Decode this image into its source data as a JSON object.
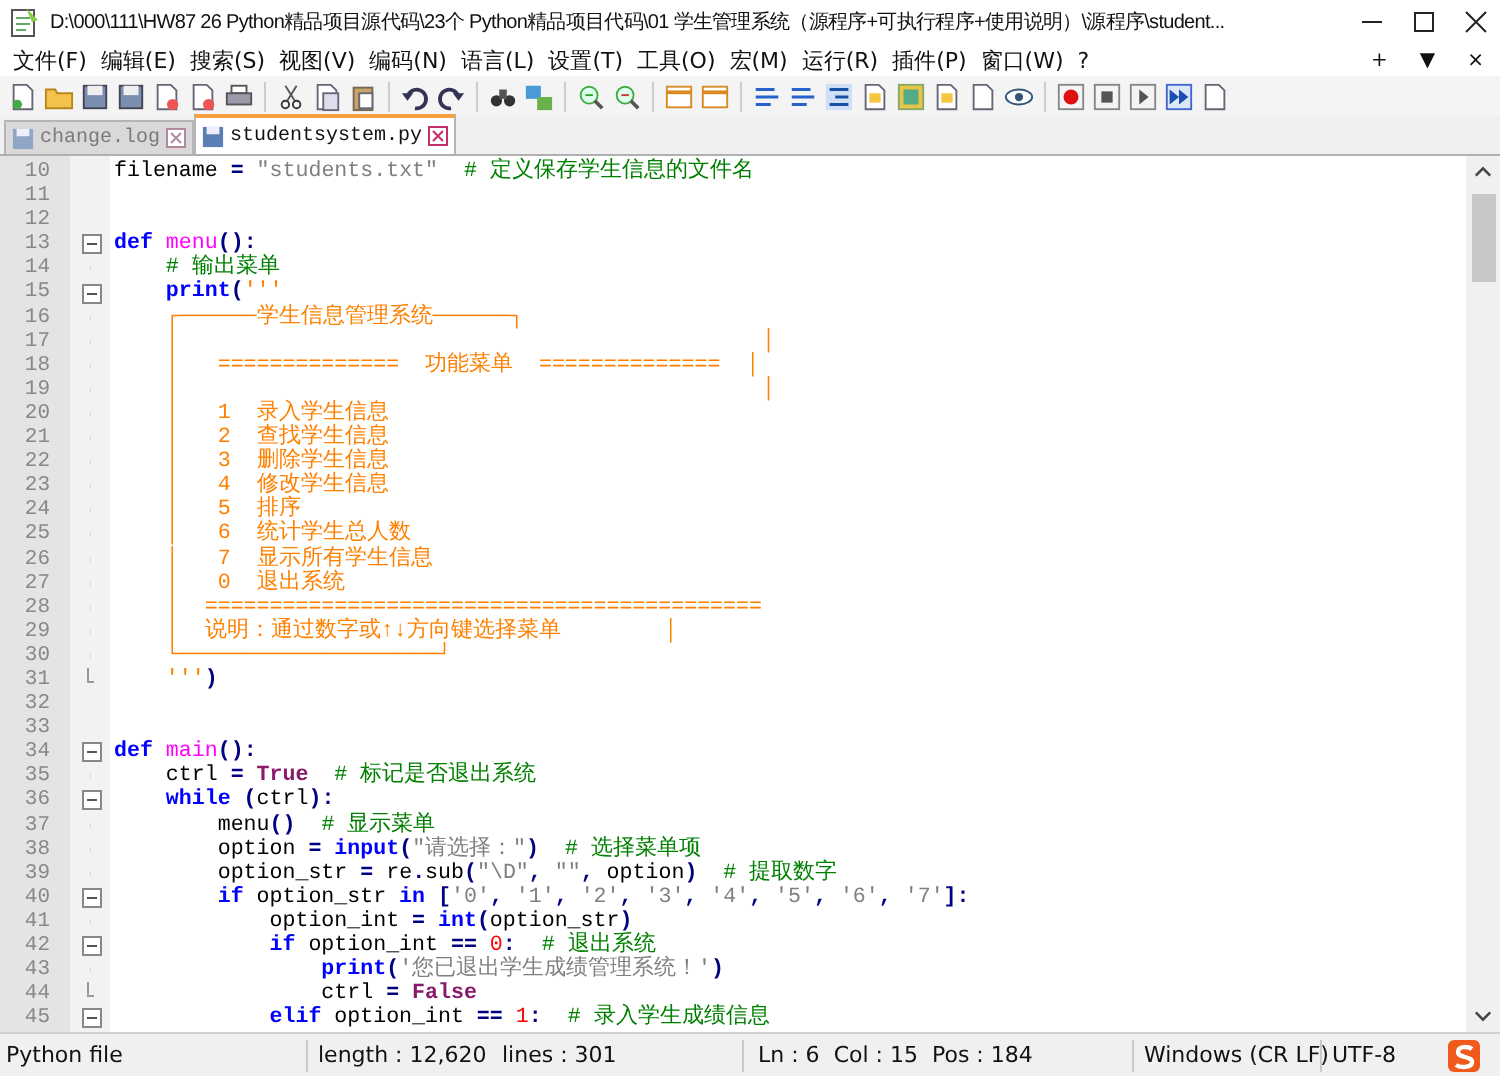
{
  "window": {
    "title": "D:\\000\\111\\HW87 26 Python精品项目源代码\\23个 Python精品项目代码\\01 学生管理系统（源程序+可执行程序+使用说明）\\源程序\\student..."
  },
  "menu": [
    "文件(F)",
    "编辑(E)",
    "搜索(S)",
    "视图(V)",
    "编码(N)",
    "语言(L)",
    "设置(T)",
    "工具(O)",
    "宏(M)",
    "运行(R)",
    "插件(P)",
    "窗口(W)",
    "?"
  ],
  "menu_right": [
    "+",
    "▼",
    "×"
  ],
  "tabs": [
    {
      "label": "change.log",
      "selected": false
    },
    {
      "label": "studentsystem.py",
      "selected": true
    }
  ],
  "lines": [
    {
      "n": "10",
      "code": [
        {
          "kind": "id",
          "t": "filename"
        },
        {
          "kind": "op",
          "t": " ="
        },
        {
          "kind": "str",
          "t": " \"students.txt\""
        },
        {
          "kind": "cmt",
          "t": "  # 定义保存学生信息的文件名"
        }
      ]
    },
    {
      "n": "11"
    },
    {
      "n": "12"
    },
    {
      "n": "13",
      "kind": "open",
      "code": [
        {
          "kind": "kw",
          "t": "def"
        },
        {
          "kind": "fn",
          "t": " menu"
        },
        {
          "kind": "op",
          "t": "():"
        }
      ]
    },
    {
      "n": "14",
      "kind": "line",
      "code": [
        {
          "kind": "cmt",
          "t": "    # 输出菜单"
        }
      ]
    },
    {
      "n": "15",
      "kind": "open",
      "code": [
        {
          "kind": "kw",
          "t": "    print"
        },
        {
          "kind": "op",
          "t": "("
        },
        {
          "kind": "doc",
          "t": "'''"
        }
      ]
    },
    {
      "n": "16",
      "kind": "line",
      "code": [
        {
          "kind": "doc",
          "t": "    ┌──────学生信息管理系统──────┐"
        }
      ]
    },
    {
      "n": "17",
      "kind": "line",
      "code": [
        {
          "kind": "doc",
          "t": "    │                                             │"
        }
      ]
    },
    {
      "n": "18",
      "kind": "line",
      "code": [
        {
          "kind": "doc",
          "t": "    │   ==============  功能菜单  ==============  │"
        }
      ]
    },
    {
      "n": "19",
      "kind": "line",
      "code": [
        {
          "kind": "doc",
          "t": "    │                                             │"
        }
      ]
    },
    {
      "n": "20",
      "kind": "line",
      "code": [
        {
          "kind": "doc",
          "t": "    │   1  录入学生信息"
        }
      ]
    },
    {
      "n": "21",
      "kind": "line",
      "code": [
        {
          "kind": "doc",
          "t": "    │   2  查找学生信息"
        }
      ]
    },
    {
      "n": "22",
      "kind": "line",
      "code": [
        {
          "kind": "doc",
          "t": "    │   3  删除学生信息"
        }
      ]
    },
    {
      "n": "23",
      "kind": "line",
      "code": [
        {
          "kind": "doc",
          "t": "    │   4  修改学生信息"
        }
      ]
    },
    {
      "n": "24",
      "kind": "line",
      "code": [
        {
          "kind": "doc",
          "t": "    │   5  排序"
        }
      ]
    },
    {
      "n": "25",
      "kind": "line",
      "code": [
        {
          "kind": "doc",
          "t": "    │   6  统计学生总人数"
        }
      ]
    },
    {
      "n": "26",
      "kind": "line",
      "code": [
        {
          "kind": "doc",
          "t": "    │   7  显示所有学生信息"
        }
      ]
    },
    {
      "n": "27",
      "kind": "line",
      "code": [
        {
          "kind": "doc",
          "t": "    │   0  退出系统"
        }
      ]
    },
    {
      "n": "28",
      "kind": "line",
      "code": [
        {
          "kind": "doc",
          "t": "    │  ==========================================="
        }
      ]
    },
    {
      "n": "29",
      "kind": "line",
      "code": [
        {
          "kind": "doc",
          "t": "    │  说明：通过数字或↑↓方向键选择菜单        │"
        }
      ]
    },
    {
      "n": "30",
      "kind": "line",
      "code": [
        {
          "kind": "doc",
          "t": "    └────────────────────┘"
        }
      ]
    },
    {
      "n": "31",
      "kind": "end",
      "code": [
        {
          "kind": "doc",
          "t": "    '''"
        },
        {
          "kind": "op",
          "t": ")"
        }
      ]
    },
    {
      "n": "32"
    },
    {
      "n": "33"
    },
    {
      "n": "34",
      "kind": "open",
      "code": [
        {
          "kind": "kw",
          "t": "def"
        },
        {
          "kind": "fn",
          "t": " main"
        },
        {
          "kind": "op",
          "t": "():"
        }
      ]
    },
    {
      "n": "35",
      "kind": "line",
      "code": [
        {
          "kind": "id",
          "t": "    ctrl"
        },
        {
          "kind": "op",
          "t": " ="
        },
        {
          "kind": "const",
          "t": " True"
        },
        {
          "kind": "cmt",
          "t": "  # 标记是否退出系统"
        }
      ]
    },
    {
      "n": "36",
      "kind": "open",
      "code": [
        {
          "kind": "kw",
          "t": "    while"
        },
        {
          "kind": "op",
          "t": " ("
        },
        {
          "kind": "id",
          "t": "ctrl"
        },
        {
          "kind": "op",
          "t": "):"
        }
      ]
    },
    {
      "n": "37",
      "kind": "line",
      "code": [
        {
          "kind": "id",
          "t": "        menu"
        },
        {
          "kind": "op",
          "t": "()"
        },
        {
          "kind": "cmt",
          "t": "  # 显示菜单"
        }
      ]
    },
    {
      "n": "38",
      "kind": "line",
      "code": [
        {
          "kind": "id",
          "t": "        option"
        },
        {
          "kind": "op",
          "t": " ="
        },
        {
          "kind": "kw",
          "t": " input"
        },
        {
          "kind": "op",
          "t": "("
        },
        {
          "kind": "str",
          "t": "\"请选择：\""
        },
        {
          "kind": "op",
          "t": ")"
        },
        {
          "kind": "cmt",
          "t": "  # 选择菜单项"
        }
      ]
    },
    {
      "n": "39",
      "kind": "line",
      "code": [
        {
          "kind": "id",
          "t": "        option_str"
        },
        {
          "kind": "op",
          "t": " ="
        },
        {
          "kind": "id",
          "t": " re"
        },
        {
          "kind": "op",
          "t": "."
        },
        {
          "kind": "id",
          "t": "sub"
        },
        {
          "kind": "op",
          "t": "("
        },
        {
          "kind": "str",
          "t": "\"\\D\""
        },
        {
          "kind": "op",
          "t": ","
        },
        {
          "kind": "str",
          "t": " \"\""
        },
        {
          "kind": "op",
          "t": ","
        },
        {
          "kind": "id",
          "t": " option"
        },
        {
          "kind": "op",
          "t": ")"
        },
        {
          "kind": "cmt",
          "t": "  # 提取数字"
        }
      ]
    },
    {
      "n": "40",
      "kind": "open",
      "code": [
        {
          "kind": "kw",
          "t": "        if"
        },
        {
          "kind": "id",
          "t": " option_str"
        },
        {
          "kind": "kw",
          "t": " in"
        },
        {
          "kind": "op",
          "t": " ["
        },
        {
          "kind": "str",
          "t": "'0'"
        },
        {
          "kind": "op",
          "t": ","
        },
        {
          "kind": "str",
          "t": " '1'"
        },
        {
          "kind": "op",
          "t": ","
        },
        {
          "kind": "str",
          "t": " '2'"
        },
        {
          "kind": "op",
          "t": ","
        },
        {
          "kind": "str",
          "t": " '3'"
        },
        {
          "kind": "op",
          "t": ","
        },
        {
          "kind": "str",
          "t": " '4'"
        },
        {
          "kind": "op",
          "t": ","
        },
        {
          "kind": "str",
          "t": " '5'"
        },
        {
          "kind": "op",
          "t": ","
        },
        {
          "kind": "str",
          "t": " '6'"
        },
        {
          "kind": "op",
          "t": ","
        },
        {
          "kind": "str",
          "t": " '7'"
        },
        {
          "kind": "op",
          "t": "]:"
        }
      ]
    },
    {
      "n": "41",
      "kind": "line",
      "code": [
        {
          "kind": "id",
          "t": "            option_int"
        },
        {
          "kind": "op",
          "t": " ="
        },
        {
          "kind": "kw",
          "t": " int"
        },
        {
          "kind": "op",
          "t": "("
        },
        {
          "kind": "id",
          "t": "option_str"
        },
        {
          "kind": "op",
          "t": ")"
        }
      ]
    },
    {
      "n": "42",
      "kind": "open",
      "code": [
        {
          "kind": "kw",
          "t": "            if"
        },
        {
          "kind": "id",
          "t": " option_int"
        },
        {
          "kind": "op",
          "t": " =="
        },
        {
          "kind": "num",
          "t": " 0"
        },
        {
          "kind": "op",
          "t": ":"
        },
        {
          "kind": "cmt",
          "t": "  # 退出系统"
        }
      ]
    },
    {
      "n": "43",
      "kind": "line",
      "code": [
        {
          "kind": "kw",
          "t": "                print"
        },
        {
          "kind": "op",
          "t": "("
        },
        {
          "kind": "str",
          "t": "'您已退出学生成绩管理系统！'"
        },
        {
          "kind": "op",
          "t": ")"
        }
      ]
    },
    {
      "n": "44",
      "kind": "end",
      "code": [
        {
          "kind": "id",
          "t": "                ctrl"
        },
        {
          "kind": "op",
          "t": " ="
        },
        {
          "kind": "const",
          "t": " False"
        }
      ]
    },
    {
      "n": "45",
      "kind": "open",
      "code": [
        {
          "kind": "kw",
          "t": "            elif"
        },
        {
          "kind": "id",
          "t": " option_int"
        },
        {
          "kind": "op",
          "t": " =="
        },
        {
          "kind": "num",
          "t": " 1"
        },
        {
          "kind": "op",
          "t": ":"
        },
        {
          "kind": "cmt",
          "t": "  # 录入学生成绩信息"
        }
      ]
    }
  ],
  "status_bar": {
    "file_type": "Python file",
    "length": "length : 12,620",
    "lines": "lines : 301",
    "ln": "Ln : 6",
    "col": "Col : 15",
    "pos": "Pos : 184",
    "eol": "Windows (CR LF)",
    "encoding": "UTF-8"
  }
}
